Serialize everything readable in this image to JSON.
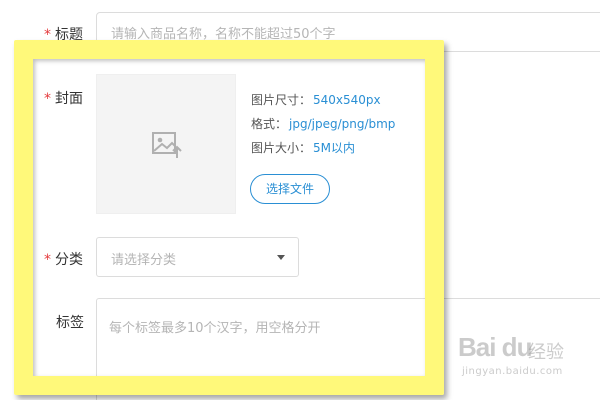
{
  "form": {
    "title": {
      "label": "标题",
      "required_mark": "*",
      "placeholder": "请输入商品名称，名称不能超过50个字"
    },
    "cover": {
      "label": "封面",
      "required_mark": "*",
      "icon": "image-upload-icon",
      "size_label": "图片尺寸：",
      "size_value": "540x540px",
      "format_label": "格式：",
      "format_value": "jpg/jpeg/png/bmp",
      "filesize_label": "图片大小：",
      "filesize_value": "5M以内",
      "choose_button": "选择文件"
    },
    "category": {
      "label": "分类",
      "required_mark": "*",
      "placeholder": "请选择分类"
    },
    "tags": {
      "label": "标签",
      "placeholder": "每个标签最多10个汉字，用空格分开"
    }
  },
  "watermark": {
    "logo": "Bai du",
    "text": "经验",
    "url": "jingyan.baidu.com"
  },
  "colors": {
    "required": "#e4393c",
    "accent": "#2a8fd4",
    "highlight": "#fff97a",
    "placeholder": "#b5b5b5"
  }
}
